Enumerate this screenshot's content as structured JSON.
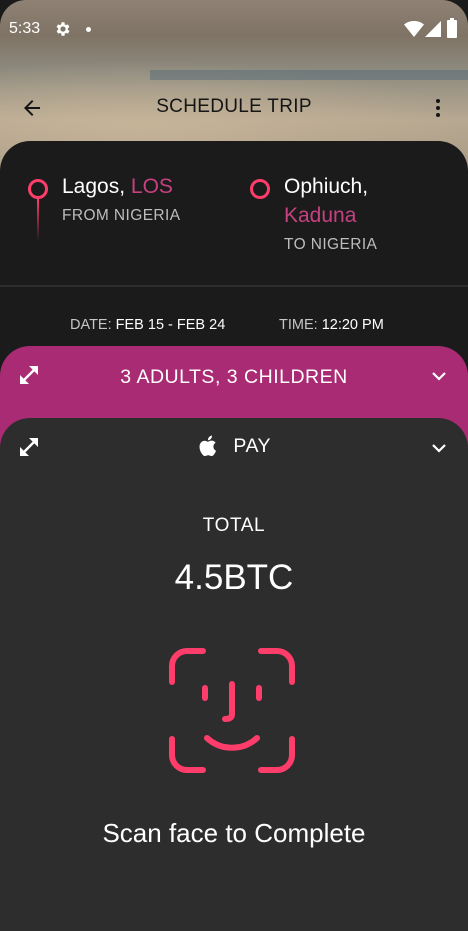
{
  "status_bar": {
    "time": "5:33",
    "icons": [
      "gear-icon",
      "dot-icon",
      "wifi-icon",
      "signal-icon",
      "battery-icon"
    ]
  },
  "toolbar": {
    "title": "SCHEDULE TRIP",
    "back_icon": "arrow-left-icon",
    "menu_icon": "more-vert-icon"
  },
  "trip": {
    "from": {
      "city": "Lagos,",
      "code": "LOS",
      "label": "FROM NIGERIA"
    },
    "to": {
      "city": "Ophiuch,",
      "code": "Kaduna",
      "label": "TO NIGERIA"
    },
    "date_label": "DATE:",
    "date_value": "FEB 15 - FEB 24",
    "time_label": "TIME:",
    "time_value": "12:20 PM"
  },
  "passengers": {
    "label": "3 ADULTS, 3 CHILDREN"
  },
  "payment": {
    "label": "PAY",
    "total_label": "TOTAL",
    "total_amount": "4.5BTC",
    "scan_label": "Scan face to Complete"
  },
  "colors": {
    "accent_pink": "#ff3d6b",
    "magenta_text": "#c7407f",
    "passengers_sheet": "#a92b73",
    "card_dark": "#1b1b1c",
    "pay_sheet": "#2d2d2e"
  }
}
